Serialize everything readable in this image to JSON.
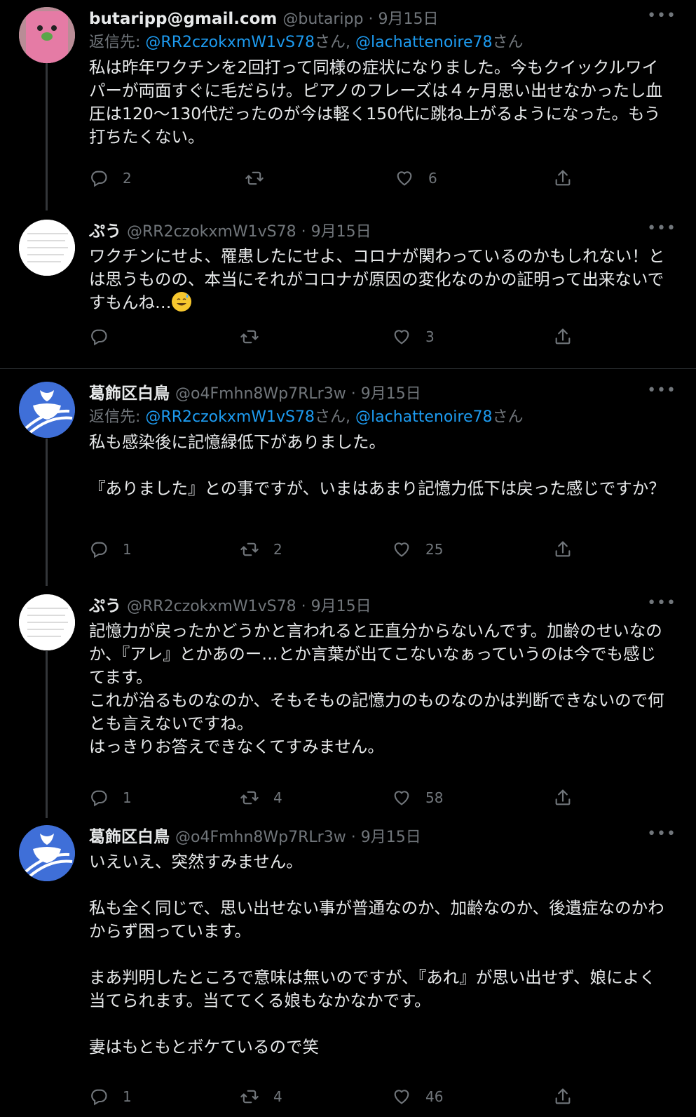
{
  "tweets": [
    {
      "name": "butaripp@gmail.com",
      "handle": "@butaripp",
      "date": "9月15日",
      "reply_prefix": "返信先: ",
      "reply_mention1": "@RR2czokxmW1vS78",
      "reply_san1": "さん, ",
      "reply_mention2": "@lachattenoire78",
      "reply_san2": "さん",
      "text": "私は昨年ワクチンを2回打って同様の症状になりました。今もクイックルワイパーが両面すぐに毛だらけ。ピアノのフレーズは４ヶ月思い出せなかったし血圧は120〜130代だったのが今は軽く150代に跳ね上がるようになった。もう打ちたくない。",
      "reply_count": "2",
      "retweet_count": "",
      "like_count": "6",
      "avatar_icon": "knit-doll-avatar"
    },
    {
      "name": "ぷう",
      "handle": "@RR2czokxmW1vS78",
      "date": "9月15日",
      "text": "ワクチンにせよ、罹患したにせよ、コロナが関わっているのかもしれない！とは思うものの、本当にそれがコロナが原因の変化なのかの証明って出来ないですもんね…",
      "emoji": "sweat-smile-emoji",
      "reply_count": "",
      "retweet_count": "",
      "like_count": "3",
      "avatar_icon": "list-screenshot-avatar"
    },
    {
      "name": "葛飾区白鳥",
      "handle": "@o4Fmhn8Wp7RLr3w",
      "date": "9月15日",
      "reply_prefix": "返信先: ",
      "reply_mention1": "@RR2czokxmW1vS78",
      "reply_san1": "さん, ",
      "reply_mention2": "@lachattenoire78",
      "reply_san2": "さん",
      "text": "私も感染後に記憶緑低下がありました。\n\n『ありました』との事ですが、いまはあまり記憶力低下は戻った感じですか？",
      "reply_count": "1",
      "retweet_count": "2",
      "like_count": "25",
      "avatar_icon": "iris-emblem-avatar"
    },
    {
      "name": "ぷう",
      "handle": "@RR2czokxmW1vS78",
      "date": "9月15日",
      "text": "記憶力が戻ったかどうかと言われると正直分からないんです。加齢のせいなのか、『アレ』とかあのー…とか言葉が出てこないなぁっていうのは今でも感じてます。\nこれが治るものなのか、そもそもの記憶力のものなのかは判断できないので何とも言えないですね。\nはっきりお答えできなくてすみません。",
      "reply_count": "1",
      "retweet_count": "4",
      "like_count": "58",
      "avatar_icon": "list-screenshot-avatar"
    },
    {
      "name": "葛飾区白鳥",
      "handle": "@o4Fmhn8Wp7RLr3w",
      "date": "9月15日",
      "text": "いえいえ、突然すみません。\n\n私も全く同じで、思い出せない事が普通なのか、加齢なのか、後遺症なのかわからず困っています。\n\nまあ判明したところで意味は無いのですが、『あれ』が思い出せず、娘によく当てられます。当ててくる娘もなかなかです。\n\n妻はもともとボケているので笑",
      "reply_count": "1",
      "retweet_count": "4",
      "like_count": "46",
      "avatar_icon": "iris-emblem-avatar"
    }
  ],
  "ui": {
    "more_glyph": "•••",
    "date_sep": " · "
  },
  "colors": {
    "background": "#000000",
    "text": "#e7e9ea",
    "muted": "#71767b",
    "accent": "#1d9bf0"
  }
}
